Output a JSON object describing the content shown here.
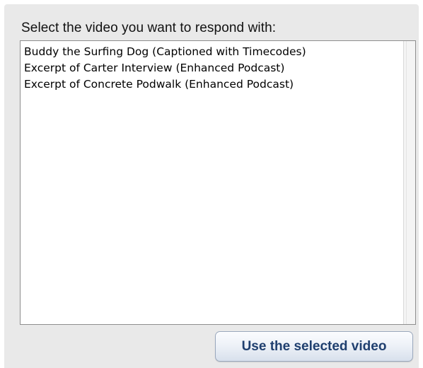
{
  "dialog": {
    "prompt": "Select the video you want to respond with:",
    "videos": [
      "Buddy the Surfing Dog (Captioned with Timecodes)",
      "Excerpt of Carter Interview (Enhanced Podcast)",
      "Excerpt of Concrete Podwalk (Enhanced Podcast)"
    ],
    "submit_label": "Use the selected video"
  }
}
